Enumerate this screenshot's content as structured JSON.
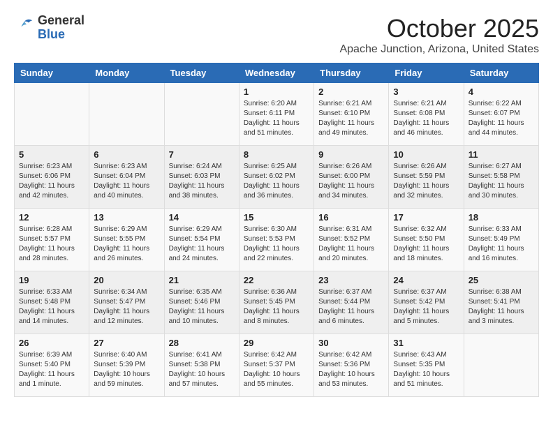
{
  "logo": {
    "general": "General",
    "blue": "Blue"
  },
  "title": "October 2025",
  "subtitle": "Apache Junction, Arizona, United States",
  "days_of_week": [
    "Sunday",
    "Monday",
    "Tuesday",
    "Wednesday",
    "Thursday",
    "Friday",
    "Saturday"
  ],
  "weeks": [
    [
      {
        "day": "",
        "info": ""
      },
      {
        "day": "",
        "info": ""
      },
      {
        "day": "",
        "info": ""
      },
      {
        "day": "1",
        "info": "Sunrise: 6:20 AM\nSunset: 6:11 PM\nDaylight: 11 hours\nand 51 minutes."
      },
      {
        "day": "2",
        "info": "Sunrise: 6:21 AM\nSunset: 6:10 PM\nDaylight: 11 hours\nand 49 minutes."
      },
      {
        "day": "3",
        "info": "Sunrise: 6:21 AM\nSunset: 6:08 PM\nDaylight: 11 hours\nand 46 minutes."
      },
      {
        "day": "4",
        "info": "Sunrise: 6:22 AM\nSunset: 6:07 PM\nDaylight: 11 hours\nand 44 minutes."
      }
    ],
    [
      {
        "day": "5",
        "info": "Sunrise: 6:23 AM\nSunset: 6:06 PM\nDaylight: 11 hours\nand 42 minutes."
      },
      {
        "day": "6",
        "info": "Sunrise: 6:23 AM\nSunset: 6:04 PM\nDaylight: 11 hours\nand 40 minutes."
      },
      {
        "day": "7",
        "info": "Sunrise: 6:24 AM\nSunset: 6:03 PM\nDaylight: 11 hours\nand 38 minutes."
      },
      {
        "day": "8",
        "info": "Sunrise: 6:25 AM\nSunset: 6:02 PM\nDaylight: 11 hours\nand 36 minutes."
      },
      {
        "day": "9",
        "info": "Sunrise: 6:26 AM\nSunset: 6:00 PM\nDaylight: 11 hours\nand 34 minutes."
      },
      {
        "day": "10",
        "info": "Sunrise: 6:26 AM\nSunset: 5:59 PM\nDaylight: 11 hours\nand 32 minutes."
      },
      {
        "day": "11",
        "info": "Sunrise: 6:27 AM\nSunset: 5:58 PM\nDaylight: 11 hours\nand 30 minutes."
      }
    ],
    [
      {
        "day": "12",
        "info": "Sunrise: 6:28 AM\nSunset: 5:57 PM\nDaylight: 11 hours\nand 28 minutes."
      },
      {
        "day": "13",
        "info": "Sunrise: 6:29 AM\nSunset: 5:55 PM\nDaylight: 11 hours\nand 26 minutes."
      },
      {
        "day": "14",
        "info": "Sunrise: 6:29 AM\nSunset: 5:54 PM\nDaylight: 11 hours\nand 24 minutes."
      },
      {
        "day": "15",
        "info": "Sunrise: 6:30 AM\nSunset: 5:53 PM\nDaylight: 11 hours\nand 22 minutes."
      },
      {
        "day": "16",
        "info": "Sunrise: 6:31 AM\nSunset: 5:52 PM\nDaylight: 11 hours\nand 20 minutes."
      },
      {
        "day": "17",
        "info": "Sunrise: 6:32 AM\nSunset: 5:50 PM\nDaylight: 11 hours\nand 18 minutes."
      },
      {
        "day": "18",
        "info": "Sunrise: 6:33 AM\nSunset: 5:49 PM\nDaylight: 11 hours\nand 16 minutes."
      }
    ],
    [
      {
        "day": "19",
        "info": "Sunrise: 6:33 AM\nSunset: 5:48 PM\nDaylight: 11 hours\nand 14 minutes."
      },
      {
        "day": "20",
        "info": "Sunrise: 6:34 AM\nSunset: 5:47 PM\nDaylight: 11 hours\nand 12 minutes."
      },
      {
        "day": "21",
        "info": "Sunrise: 6:35 AM\nSunset: 5:46 PM\nDaylight: 11 hours\nand 10 minutes."
      },
      {
        "day": "22",
        "info": "Sunrise: 6:36 AM\nSunset: 5:45 PM\nDaylight: 11 hours\nand 8 minutes."
      },
      {
        "day": "23",
        "info": "Sunrise: 6:37 AM\nSunset: 5:44 PM\nDaylight: 11 hours\nand 6 minutes."
      },
      {
        "day": "24",
        "info": "Sunrise: 6:37 AM\nSunset: 5:42 PM\nDaylight: 11 hours\nand 5 minutes."
      },
      {
        "day": "25",
        "info": "Sunrise: 6:38 AM\nSunset: 5:41 PM\nDaylight: 11 hours\nand 3 minutes."
      }
    ],
    [
      {
        "day": "26",
        "info": "Sunrise: 6:39 AM\nSunset: 5:40 PM\nDaylight: 11 hours\nand 1 minute."
      },
      {
        "day": "27",
        "info": "Sunrise: 6:40 AM\nSunset: 5:39 PM\nDaylight: 10 hours\nand 59 minutes."
      },
      {
        "day": "28",
        "info": "Sunrise: 6:41 AM\nSunset: 5:38 PM\nDaylight: 10 hours\nand 57 minutes."
      },
      {
        "day": "29",
        "info": "Sunrise: 6:42 AM\nSunset: 5:37 PM\nDaylight: 10 hours\nand 55 minutes."
      },
      {
        "day": "30",
        "info": "Sunrise: 6:42 AM\nSunset: 5:36 PM\nDaylight: 10 hours\nand 53 minutes."
      },
      {
        "day": "31",
        "info": "Sunrise: 6:43 AM\nSunset: 5:35 PM\nDaylight: 10 hours\nand 51 minutes."
      },
      {
        "day": "",
        "info": ""
      }
    ]
  ]
}
